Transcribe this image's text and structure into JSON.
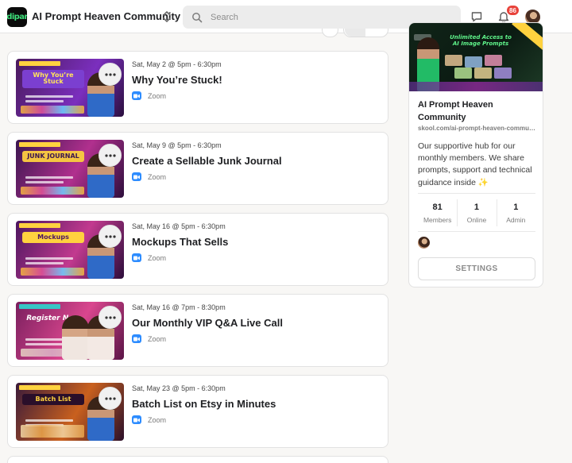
{
  "header": {
    "logo_text": "dipar",
    "community_name": "AI Prompt Heaven Community",
    "search_placeholder": "Search",
    "notification_count": "86"
  },
  "events": [
    {
      "time": "Sat, May 2 @ 5pm - 6:30pm",
      "title": "Why You’re Stuck!",
      "location": "Zoom",
      "thumb_text": "Why You’re Stuck",
      "thumb_bg": "#4a1a5c",
      "thumb_accent": "#7b2fbe"
    },
    {
      "time": "Sat, May 9 @ 5pm - 6:30pm",
      "title": "Create a Sellable Junk Journal",
      "location": "Zoom",
      "thumb_text": "JUNK JOURNAL",
      "thumb_bg": "#3b1650",
      "thumb_accent": "#b1308e"
    },
    {
      "time": "Sat, May 16 @ 5pm - 6:30pm",
      "title": "Mockups That Sells",
      "location": "Zoom",
      "thumb_text": "Mockups",
      "thumb_bg": "#4c1660",
      "thumb_accent": "#c23a8f"
    },
    {
      "time": "Sat, May 16 @ 7pm - 8:30pm",
      "title": "Our Monthly VIP Q&A Live Call",
      "location": "Zoom",
      "thumb_text": "Register Now",
      "thumb_bg": "#7a1f5e",
      "thumb_accent": "#d9468e"
    },
    {
      "time": "Sat, May 23 @ 5pm - 6:30pm",
      "title": "Batch List on Etsy in Minutes",
      "location": "Zoom",
      "thumb_text": "Batch List",
      "thumb_bg": "#3a1a3a",
      "thumb_accent": "#c9601e"
    }
  ],
  "sidebar": {
    "cover_text": "Unlimited Access to AI Image Prompts",
    "name": "AI Prompt Heaven Community",
    "url": "skool.com/ai-prompt-heaven-community",
    "description": "Our supportive hub for our monthly members. We share prompts, support and technical guidance inside ✨",
    "stats": [
      {
        "value": "81",
        "label": "Members"
      },
      {
        "value": "1",
        "label": "Online"
      },
      {
        "value": "1",
        "label": "Admin"
      }
    ],
    "settings_label": "SETTINGS"
  },
  "colors": {
    "zoom_blue": "#2d8cff",
    "badge_red": "#e8423a",
    "logo_green": "#3ee07a"
  },
  "icons": [
    "chevron-updown-icon",
    "search-icon",
    "chat-icon",
    "bell-icon",
    "more-dots-icon",
    "zoom-icon"
  ]
}
